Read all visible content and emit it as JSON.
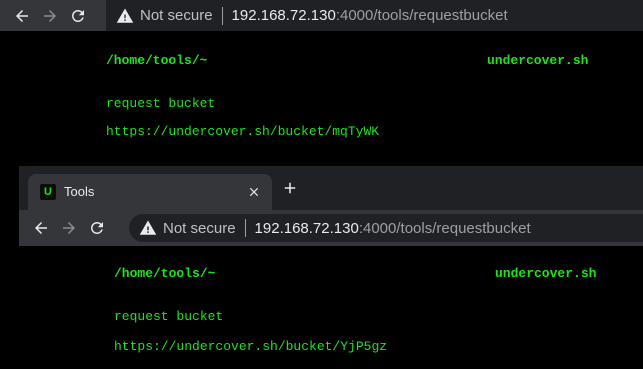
{
  "back_window": {
    "address": {
      "security_label": "Not secure",
      "host": "192.168.72.130",
      "path": ":4000/tools/requestbucket"
    },
    "page": {
      "cwd": "/home/tools/~",
      "brand": "undercover.sh",
      "heading": "request bucket",
      "bucket_url": "https://undercover.sh/bucket/mqTyWK"
    }
  },
  "front_window": {
    "tab": {
      "favicon_letter": "U",
      "title": "Tools"
    },
    "address": {
      "security_label": "Not secure",
      "host": "192.168.72.130",
      "path": ":4000/tools/requestbucket"
    },
    "page": {
      "cwd": "/home/tools/~",
      "brand": "undercover.sh",
      "heading": "request bucket",
      "bucket_url": "https://undercover.sh/bucket/YjP5gz"
    }
  },
  "colors": {
    "terminal_green": "#19e619",
    "toolbar": "#35363a",
    "omnibox": "#202124"
  },
  "icons": [
    "back-arrow-icon",
    "forward-arrow-icon",
    "reload-icon",
    "warning-triangle-icon",
    "close-icon",
    "plus-icon"
  ]
}
